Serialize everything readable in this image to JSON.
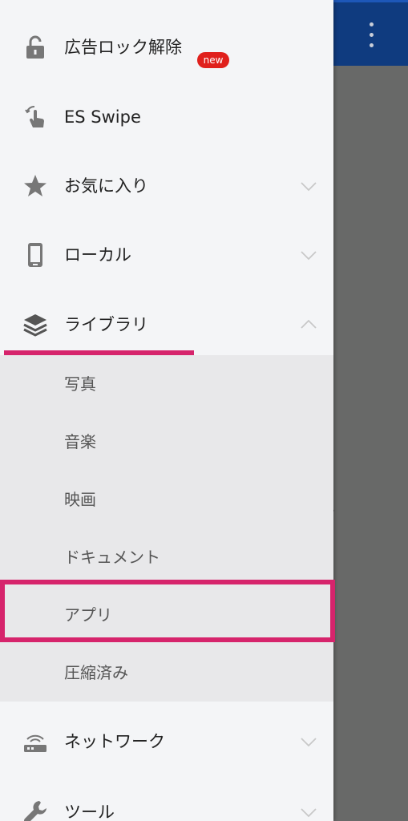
{
  "background": {
    "partial_text": "ん",
    "menu_icon": "more-vert-icon"
  },
  "drawer": {
    "top_items": [
      {
        "label": "広告ロック解除",
        "icon": "lock-open-icon",
        "badge": "new"
      },
      {
        "label": "ES Swipe",
        "icon": "swipe-hand-icon"
      },
      {
        "label": "お気に入り",
        "icon": "star-icon",
        "expandable": true,
        "expanded": false
      },
      {
        "label": "ローカル",
        "icon": "phone-icon",
        "expandable": true,
        "expanded": false
      },
      {
        "label": "ライブラリ",
        "icon": "layers-icon",
        "expandable": true,
        "expanded": true
      }
    ],
    "library_items": [
      "写真",
      "音楽",
      "映画",
      "ドキュメント",
      "アプリ",
      "圧縮済み"
    ],
    "bottom_items": [
      {
        "label": "ネットワーク",
        "icon": "router-icon",
        "expandable": true,
        "expanded": false
      },
      {
        "label": "ツール",
        "icon": "wrench-icon",
        "expandable": true,
        "expanded": false
      }
    ],
    "highlighted_item": "アプリ"
  },
  "colors": {
    "appbar": "#0f3b7f",
    "accent_highlight": "#d6246c",
    "badge": "#e0201c",
    "drawer_bg": "#f4f5f7",
    "submenu_bg": "#e8e8ea"
  }
}
